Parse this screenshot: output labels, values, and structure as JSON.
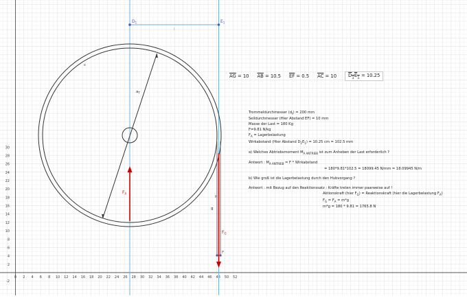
{
  "axes": {
    "x_ticks": [
      "0",
      "2",
      "4",
      "6",
      "8",
      "10",
      "12",
      "14",
      "16",
      "18",
      "20",
      "22",
      "24",
      "26",
      "28",
      "30",
      "32",
      "34",
      "36",
      "38",
      "40",
      "42",
      "44",
      "46",
      "48",
      "50",
      "52"
    ],
    "y_ticks": [
      "-2",
      "2",
      "4",
      "6",
      "8",
      "10",
      "12",
      "14",
      "16",
      "18",
      "20",
      "22",
      "24",
      "26",
      "28",
      "30"
    ]
  },
  "points": {
    "d1": "D",
    "d1_sub": "1",
    "e1": "E",
    "e1_sub": "1",
    "f": "F"
  },
  "labels": {
    "segment_l": "l",
    "circle_c": "c",
    "radius": "a",
    "radius_sub": "T",
    "fa": "F",
    "fa_sub": "A",
    "fg": "F",
    "fg_sub": "G",
    "h": "h",
    "g": "g"
  },
  "lengths": [
    {
      "label": "AG",
      "value": "10"
    },
    {
      "label": "AB",
      "value": "10.5"
    },
    {
      "label": "EF",
      "value": "0.5"
    },
    {
      "label": "AC",
      "value": "10"
    }
  ],
  "lengths_boxed": {
    "label": "D",
    "label_sub1": "1",
    "label_mid": "E",
    "label_sub2": "1",
    "value": "10.25"
  },
  "info": {
    "l1": "Trommeldurchmesser (d",
    "l1_sub": "t",
    "l1_end": ") = 200 mm",
    "l2": "Seildurchmesser (Hier Abstand EF) = 10 mm",
    "l3": "Masse der Last = 180 Kg",
    "l4": "F=9.81 N/kg",
    "l5a": "F",
    "l5_sub": "A",
    "l5b": " = Lagerbelastung",
    "l6a": "Wirkabstand (Hier Abstand D",
    "l6_s1": "1",
    "l6b": "E",
    "l6_s2": "1",
    "l6c": ") = 10.25 cm = 102.5 mm",
    "q_a1": "a) Welches Abtriebsmoment M",
    "q_a_sub": "A ANTRIEB",
    "q_a2": " ist zum Anheben der Last erforderlich ?",
    "ans1_a": "Antwort : M",
    "ans1_sub": "A ANTRIEB",
    "ans1_b": " = F * Wirkabstand",
    "ans1_c": "= 180*9.81*102.5 = 18099.45 N/mm = 18.09945 N/m",
    "q_b": "b) Wie groß ist die Lagerbelastung durch den Hubvorgang ?",
    "ans2_a": "Antwort : mit Bezug auf den Reaktionssatz : Kräfte treten immer paarweise auf !",
    "ans2_b1": "Aktionskraft (hier F",
    "ans2_b_sub": "G",
    "ans2_b2": ") = Reaktionskraft (hier die Lagerbelastung F",
    "ans2_b_sub2": "A",
    "ans2_b3": ")",
    "ans2_c1": "F",
    "ans2_c_sub1": "G",
    "ans2_c2": " = F",
    "ans2_c_sub2": "A",
    "ans2_c3": " = m*g",
    "ans2_d": "m*g = 180 * 9.81 = 1765.8 N"
  },
  "colors": {
    "grid": "#e4e4e4",
    "axis": "#555555",
    "line_blue": "#6fb4e0",
    "point": "#4a5ab0",
    "force_red": "#cc0000",
    "circle": "#333333"
  }
}
